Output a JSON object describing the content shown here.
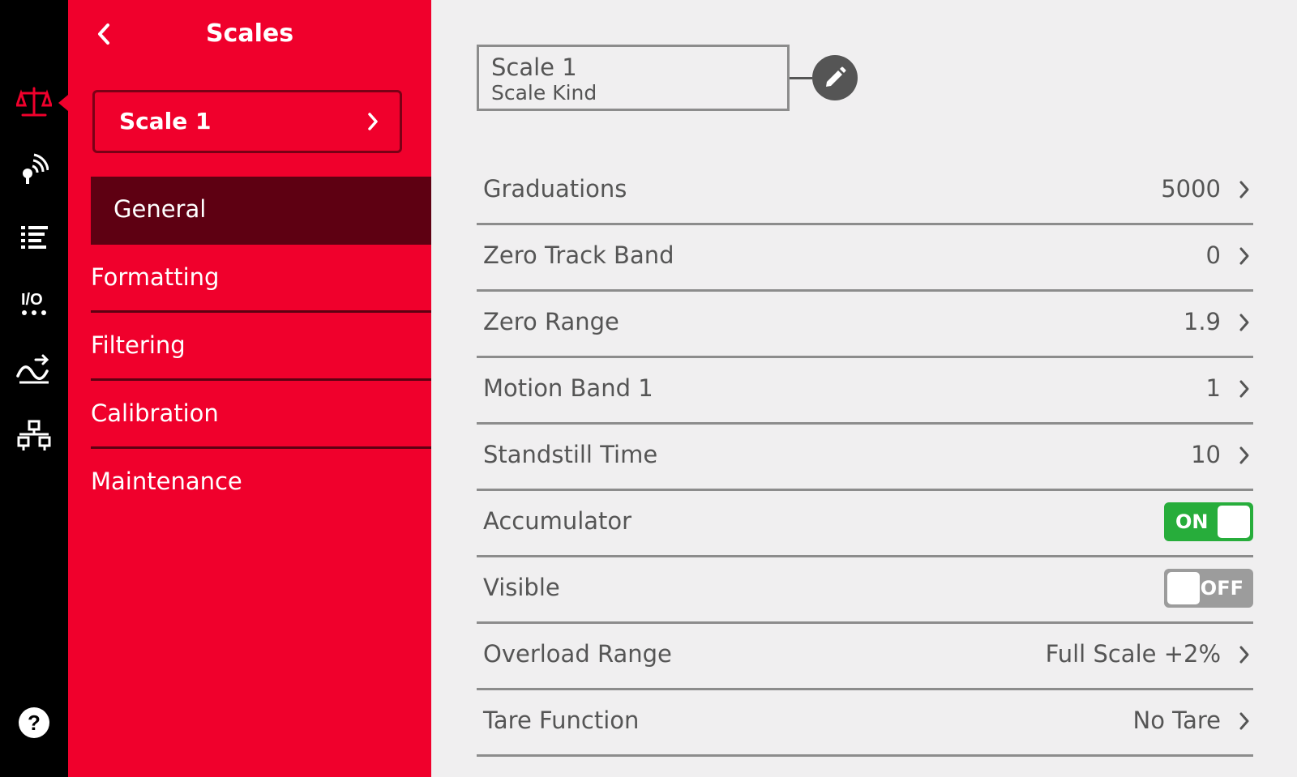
{
  "rail": {
    "icons": [
      {
        "name": "scale-icon",
        "active": true
      },
      {
        "name": "wireless-icon",
        "active": false
      },
      {
        "name": "list-icon",
        "active": false
      },
      {
        "name": "io-icon",
        "active": false
      },
      {
        "name": "signal-icon",
        "active": false
      },
      {
        "name": "network-icon",
        "active": false
      },
      {
        "name": "help-icon",
        "active": false
      }
    ],
    "active_color": "#f0002c"
  },
  "nav": {
    "title": "Scales",
    "selected_scale": "Scale 1",
    "items": [
      "General",
      "Formatting",
      "Filtering",
      "Calibration",
      "Maintenance"
    ],
    "active_item": "General"
  },
  "content": {
    "title": "Scale 1",
    "subtitle": "Scale Kind",
    "rows": [
      {
        "label": "Graduations",
        "value": "5000"
      },
      {
        "label": "Zero Track Band",
        "value": "0"
      },
      {
        "label": "Zero Range",
        "value": "1.9"
      },
      {
        "label": "Motion Band 1",
        "value": "1"
      },
      {
        "label": "Standstill Time",
        "value": "10"
      },
      {
        "label": "Accumulator",
        "toggle": "ON"
      },
      {
        "label": "Visible",
        "toggle": "OFF"
      },
      {
        "label": "Overload Range",
        "value": "Full Scale +2%"
      },
      {
        "label": "Tare Function",
        "value": "No Tare"
      }
    ]
  },
  "colors": {
    "brand_red": "#f0002c",
    "active_nav_bg": "#5e0012",
    "toggle_on": "#27ad3b",
    "toggle_off": "#9c9c9c"
  }
}
